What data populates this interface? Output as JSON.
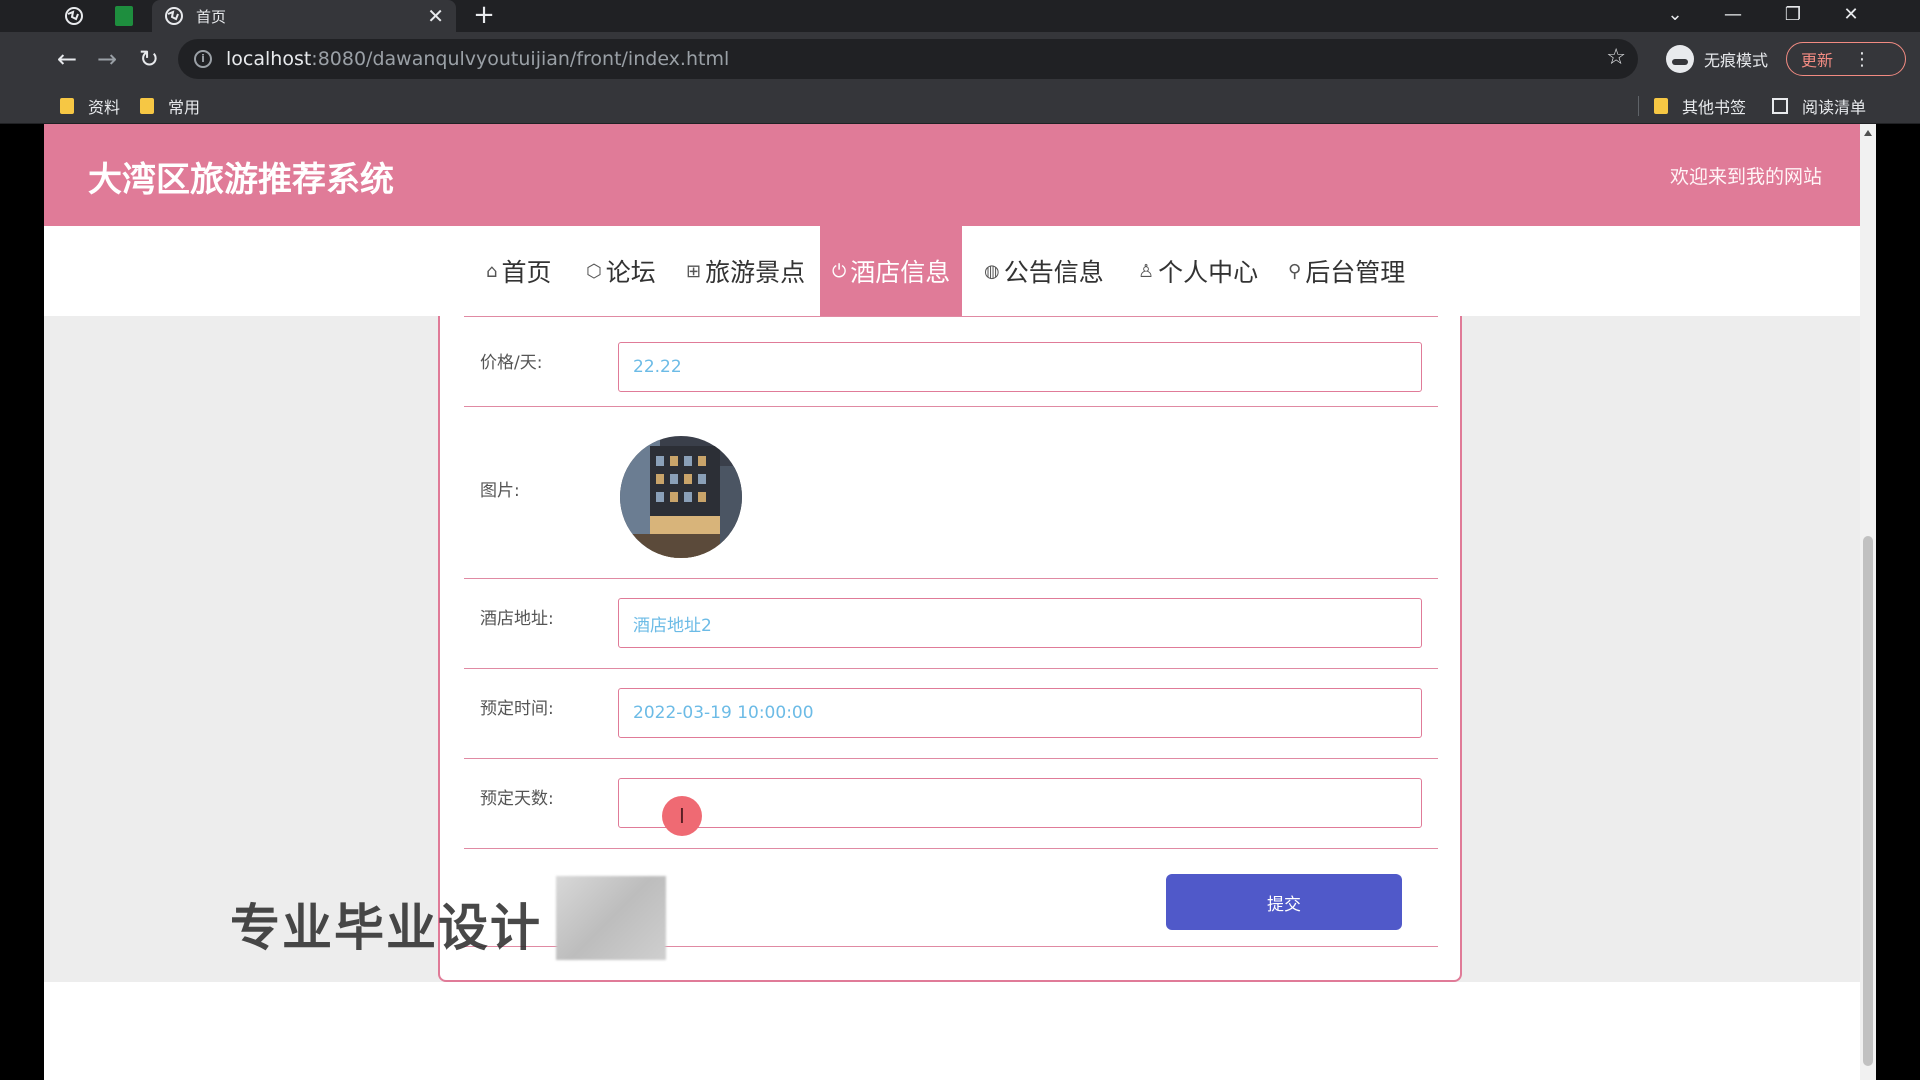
{
  "browser": {
    "tab_title": "首页",
    "close_glyph": "✕",
    "new_tab_glyph": "+",
    "url_host": "localhost",
    "url_rest": ":8080/dawanqulvyoutuijian/front/index.html",
    "incognito_label": "无痕模式",
    "update_label": "更新",
    "bookmarks": [
      "资料",
      "常用"
    ],
    "other_bookmarks": "其他书签",
    "reading_list": "阅读清单"
  },
  "site": {
    "title": "大湾区旅游推荐系统",
    "welcome": "欢迎来到我的网站"
  },
  "nav": [
    {
      "icon": "home-icon",
      "glyph": "⌂",
      "label": "首页"
    },
    {
      "icon": "forum-icon",
      "glyph": "⬡",
      "label": "论坛"
    },
    {
      "icon": "scenic-icon",
      "glyph": "⊞",
      "label": "旅游景点"
    },
    {
      "icon": "power-icon",
      "glyph": "⏻",
      "label": "酒店信息",
      "active": true
    },
    {
      "icon": "globe-icon",
      "glyph": "◍",
      "label": "公告信息"
    },
    {
      "icon": "user-icon",
      "glyph": "♙",
      "label": "个人中心"
    },
    {
      "icon": "link-icon",
      "glyph": "⚲",
      "label": "后台管理"
    }
  ],
  "form": {
    "price_label": "价格/天:",
    "price_value": "22.22",
    "image_label": "图片:",
    "address_label": "酒店地址:",
    "address_value": "酒店地址2",
    "booking_time_label": "预定时间:",
    "booking_time_value": "2022-03-19 10:00:00",
    "booking_days_label": "预定天数:",
    "booking_days_value": "",
    "submit_label": "提交"
  },
  "overlay": {
    "watermark": "专业毕业设计",
    "cursor_glyph": "I"
  },
  "colors": {
    "brand_pink": "#e07b98",
    "submit_blue": "#5059c9",
    "value_text": "#6cbbe6"
  }
}
